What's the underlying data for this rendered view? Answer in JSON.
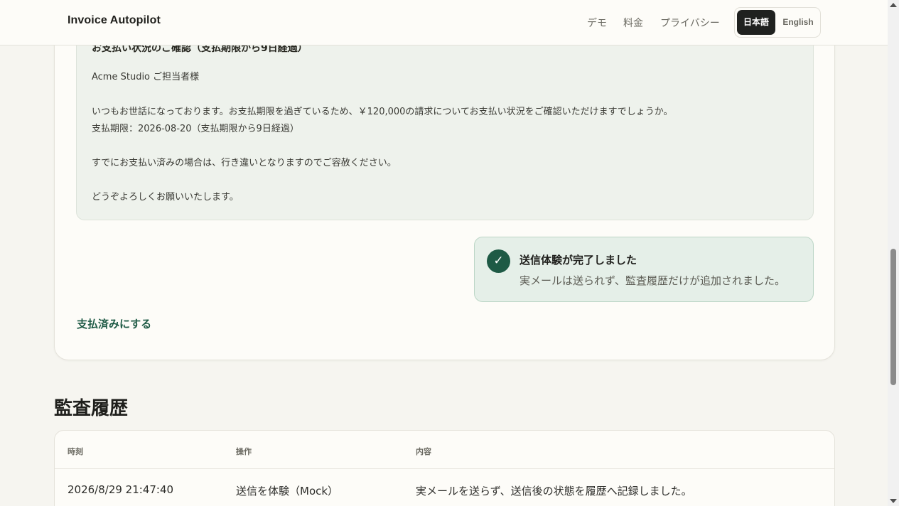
{
  "header": {
    "brand": "Invoice Autopilot",
    "nav": {
      "demo": "デモ",
      "pricing": "料金",
      "privacy": "プライバシー"
    },
    "languages": {
      "japanese": "日本語",
      "english": "English",
      "selected": "日本語"
    }
  },
  "mail_preview": {
    "subject": "お支払い状況のご確認（支払期限から9日経過）",
    "recipient_line": "Acme Studio ご担当者様",
    "body_line_1": "いつもお世話になっております。お支払期限を過ぎているため、￥120,000の請求についてお支払い状況をご確認いただけますでしょうか。",
    "body_line_2": "支払期限：2026-08-20（支払期限から9日経過）",
    "body_line_3": "すでにお支払い済みの場合は、行き違いとなりますのでご容赦ください。",
    "body_line_4": "どうぞよろしくお願いいたします。"
  },
  "toast": {
    "title": "送信体験が完了しました",
    "description": "実メールは送られず、監査履歴だけが追加されました。"
  },
  "actions": {
    "mark_paid": "支払済みにする"
  },
  "audit": {
    "title": "監査履歴",
    "columns": {
      "time": "時刻",
      "operation": "操作",
      "detail": "内容"
    },
    "rows": [
      {
        "time": "2026/8/29 21:47:40",
        "operation": "送信を体験（Mock）",
        "detail": "実メールを送らず、送信後の状態を履歴へ記録しました。"
      }
    ]
  },
  "colors": {
    "accent": "#1e5a45",
    "page_background": "#f6f5f0",
    "mail_background": "#eef2ec",
    "toast_background": "#e5efe8"
  },
  "icons": {
    "toast": "check-circle-icon"
  }
}
